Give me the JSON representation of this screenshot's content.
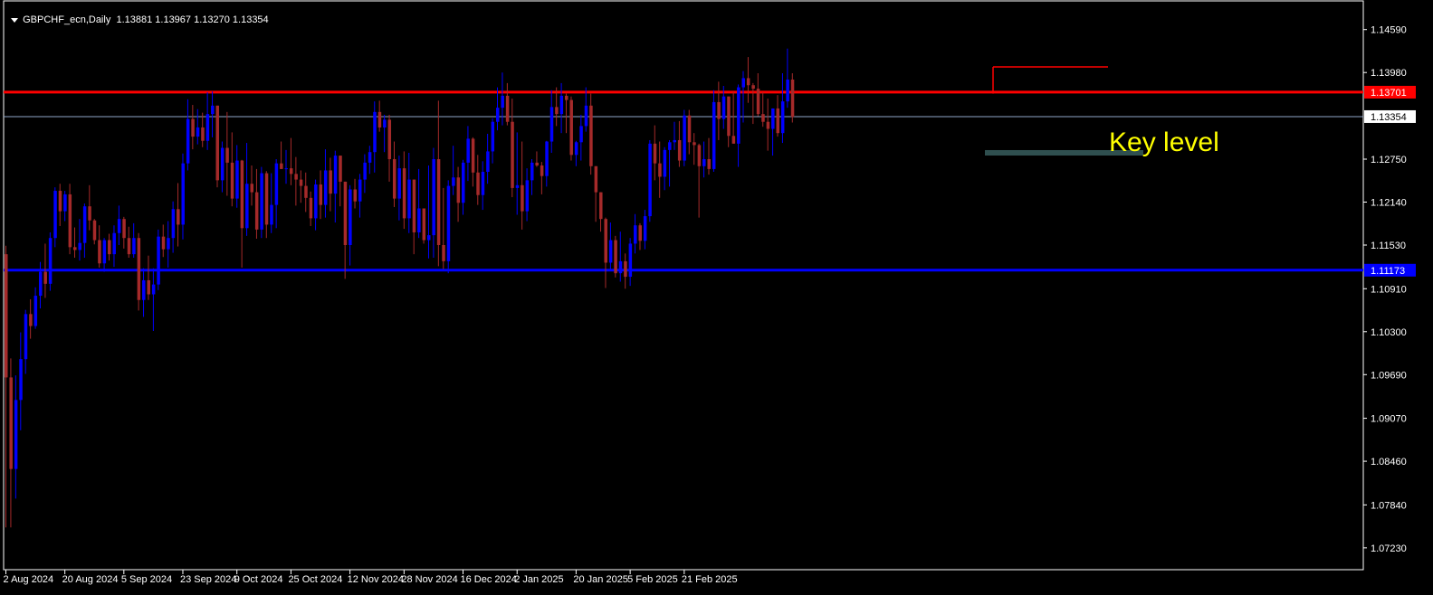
{
  "header": {
    "symbol_timeframe": "GBPCHF_ecn,Daily",
    "ohlc": "1.13881 1.13967 1.13270 1.13354"
  },
  "annotation": {
    "text": "Key level"
  },
  "colors": {
    "background": "#000000",
    "bull": "#0000ff",
    "bear": "#a52a2a",
    "axis": "#ffffff",
    "resistance": "#ff0000",
    "support": "#0000ff",
    "key_zone": "#2f4f4f",
    "annotation": "#ffff00"
  },
  "chart_data": {
    "type": "candlestick",
    "title": "GBPCHF_ecn,Daily",
    "ylim": [
      1.0692,
      1.1501
    ],
    "y_ticks": [
      "1.14590",
      "1.13980",
      "1.12750",
      "1.12140",
      "1.11530",
      "1.10910",
      "1.10300",
      "1.09690",
      "1.09070",
      "1.08460",
      "1.07840",
      "1.07230"
    ],
    "x_ticks": [
      "2 Aug 2024",
      "20 Aug 2024",
      "5 Sep 2024",
      "23 Sep 2024",
      "9 Oct 2024",
      "25 Oct 2024",
      "12 Nov 2024",
      "28 Nov 2024",
      "16 Dec 2024",
      "2 Jan 2025",
      "20 Jan 2025",
      "5 Feb 2025",
      "21 Feb 2025"
    ],
    "levels": [
      {
        "label": "1.13701",
        "price": 1.13701,
        "color": "#ff0000"
      },
      {
        "label": "1.11173",
        "price": 1.11173,
        "color": "#0000ff"
      }
    ],
    "current_price": {
      "label": "1.13354",
      "price": 1.13354
    },
    "key_zone": {
      "price": 1.1284,
      "label": "Key level"
    },
    "range_top": {
      "price": 1.1406
    },
    "candles": [
      {
        "o": 1.114,
        "h": 1.1152,
        "l": 1.0752,
        "c": 1.0965
      },
      {
        "o": 1.0965,
        "h": 1.0992,
        "l": 1.0752,
        "c": 1.0835
      },
      {
        "o": 1.0835,
        "h": 1.0968,
        "l": 1.0793,
        "c": 1.0933
      },
      {
        "o": 1.0933,
        "h": 1.1029,
        "l": 1.089,
        "c": 1.0991
      },
      {
        "o": 1.0991,
        "h": 1.1061,
        "l": 1.097,
        "c": 1.1055
      },
      {
        "o": 1.1055,
        "h": 1.1076,
        "l": 1.102,
        "c": 1.1038
      },
      {
        "o": 1.1038,
        "h": 1.1093,
        "l": 1.1034,
        "c": 1.1081
      },
      {
        "o": 1.1081,
        "h": 1.1129,
        "l": 1.1063,
        "c": 1.1115
      },
      {
        "o": 1.1115,
        "h": 1.1155,
        "l": 1.1078,
        "c": 1.1098
      },
      {
        "o": 1.1098,
        "h": 1.1171,
        "l": 1.1088,
        "c": 1.1163
      },
      {
        "o": 1.1163,
        "h": 1.1235,
        "l": 1.115,
        "c": 1.123
      },
      {
        "o": 1.123,
        "h": 1.124,
        "l": 1.118,
        "c": 1.1201
      },
      {
        "o": 1.1201,
        "h": 1.123,
        "l": 1.1187,
        "c": 1.1225
      },
      {
        "o": 1.1225,
        "h": 1.124,
        "l": 1.114,
        "c": 1.115
      },
      {
        "o": 1.115,
        "h": 1.1178,
        "l": 1.1135,
        "c": 1.1146
      },
      {
        "o": 1.1146,
        "h": 1.119,
        "l": 1.1131,
        "c": 1.1156
      },
      {
        "o": 1.1156,
        "h": 1.1212,
        "l": 1.1135,
        "c": 1.1208
      },
      {
        "o": 1.1208,
        "h": 1.1238,
        "l": 1.1174,
        "c": 1.1188
      },
      {
        "o": 1.1188,
        "h": 1.119,
        "l": 1.1154,
        "c": 1.116
      },
      {
        "o": 1.116,
        "h": 1.1181,
        "l": 1.1121,
        "c": 1.1127
      },
      {
        "o": 1.1127,
        "h": 1.1163,
        "l": 1.1115,
        "c": 1.116
      },
      {
        "o": 1.116,
        "h": 1.1169,
        "l": 1.1131,
        "c": 1.114
      },
      {
        "o": 1.114,
        "h": 1.1181,
        "l": 1.1122,
        "c": 1.117
      },
      {
        "o": 1.117,
        "h": 1.1209,
        "l": 1.1153,
        "c": 1.119
      },
      {
        "o": 1.119,
        "h": 1.1193,
        "l": 1.1148,
        "c": 1.1163
      },
      {
        "o": 1.1163,
        "h": 1.1179,
        "l": 1.1135,
        "c": 1.114
      },
      {
        "o": 1.114,
        "h": 1.1184,
        "l": 1.1135,
        "c": 1.1163
      },
      {
        "o": 1.1163,
        "h": 1.117,
        "l": 1.106,
        "c": 1.1075
      },
      {
        "o": 1.1075,
        "h": 1.112,
        "l": 1.1051,
        "c": 1.1103
      },
      {
        "o": 1.1103,
        "h": 1.1138,
        "l": 1.1075,
        "c": 1.1083
      },
      {
        "o": 1.1083,
        "h": 1.112,
        "l": 1.1031,
        "c": 1.1097
      },
      {
        "o": 1.1097,
        "h": 1.1175,
        "l": 1.1089,
        "c": 1.1165
      },
      {
        "o": 1.1165,
        "h": 1.1182,
        "l": 1.1136,
        "c": 1.1147
      },
      {
        "o": 1.1147,
        "h": 1.1187,
        "l": 1.1121,
        "c": 1.1163
      },
      {
        "o": 1.1163,
        "h": 1.1215,
        "l": 1.1142,
        "c": 1.1204
      },
      {
        "o": 1.1204,
        "h": 1.1241,
        "l": 1.1151,
        "c": 1.1182
      },
      {
        "o": 1.1182,
        "h": 1.1283,
        "l": 1.1161,
        "c": 1.1269
      },
      {
        "o": 1.1269,
        "h": 1.136,
        "l": 1.1259,
        "c": 1.1332
      },
      {
        "o": 1.1332,
        "h": 1.1352,
        "l": 1.1289,
        "c": 1.1307
      },
      {
        "o": 1.1307,
        "h": 1.1346,
        "l": 1.1296,
        "c": 1.132
      },
      {
        "o": 1.132,
        "h": 1.1341,
        "l": 1.1292,
        "c": 1.1301
      },
      {
        "o": 1.1301,
        "h": 1.137,
        "l": 1.1288,
        "c": 1.1339
      },
      {
        "o": 1.1339,
        "h": 1.1371,
        "l": 1.1306,
        "c": 1.1351
      },
      {
        "o": 1.1351,
        "h": 1.1351,
        "l": 1.1235,
        "c": 1.1245
      },
      {
        "o": 1.1245,
        "h": 1.13,
        "l": 1.1228,
        "c": 1.1291
      },
      {
        "o": 1.1291,
        "h": 1.1342,
        "l": 1.1223,
        "c": 1.127
      },
      {
        "o": 1.127,
        "h": 1.1313,
        "l": 1.1208,
        "c": 1.1219
      },
      {
        "o": 1.1219,
        "h": 1.1295,
        "l": 1.1206,
        "c": 1.1273
      },
      {
        "o": 1.1273,
        "h": 1.1274,
        "l": 1.1121,
        "c": 1.1177
      },
      {
        "o": 1.1177,
        "h": 1.1298,
        "l": 1.1166,
        "c": 1.124
      },
      {
        "o": 1.124,
        "h": 1.1266,
        "l": 1.1209,
        "c": 1.1228
      },
      {
        "o": 1.1228,
        "h": 1.1261,
        "l": 1.1162,
        "c": 1.1175
      },
      {
        "o": 1.1175,
        "h": 1.1264,
        "l": 1.1163,
        "c": 1.1255
      },
      {
        "o": 1.1255,
        "h": 1.1258,
        "l": 1.1163,
        "c": 1.1182
      },
      {
        "o": 1.1182,
        "h": 1.1255,
        "l": 1.117,
        "c": 1.121
      },
      {
        "o": 1.121,
        "h": 1.1275,
        "l": 1.1177,
        "c": 1.1269
      },
      {
        "o": 1.1269,
        "h": 1.13,
        "l": 1.1264,
        "c": 1.1261
      },
      {
        "o": 1.1261,
        "h": 1.1288,
        "l": 1.124,
        "c": 1.1262
      },
      {
        "o": 1.1262,
        "h": 1.1305,
        "l": 1.1238,
        "c": 1.1254
      },
      {
        "o": 1.1254,
        "h": 1.1278,
        "l": 1.1209,
        "c": 1.1246
      },
      {
        "o": 1.1246,
        "h": 1.1259,
        "l": 1.1213,
        "c": 1.1237
      },
      {
        "o": 1.1237,
        "h": 1.1256,
        "l": 1.12,
        "c": 1.122
      },
      {
        "o": 1.122,
        "h": 1.1229,
        "l": 1.118,
        "c": 1.1191
      },
      {
        "o": 1.1191,
        "h": 1.1246,
        "l": 1.1174,
        "c": 1.1239
      },
      {
        "o": 1.1239,
        "h": 1.1259,
        "l": 1.119,
        "c": 1.121
      },
      {
        "o": 1.121,
        "h": 1.1289,
        "l": 1.1192,
        "c": 1.1259
      },
      {
        "o": 1.1259,
        "h": 1.1277,
        "l": 1.1201,
        "c": 1.1226
      },
      {
        "o": 1.1226,
        "h": 1.1287,
        "l": 1.1185,
        "c": 1.128
      },
      {
        "o": 1.128,
        "h": 1.1278,
        "l": 1.1208,
        "c": 1.1243
      },
      {
        "o": 1.1243,
        "h": 1.1236,
        "l": 1.1105,
        "c": 1.1153
      },
      {
        "o": 1.1153,
        "h": 1.1238,
        "l": 1.1124,
        "c": 1.1232
      },
      {
        "o": 1.1232,
        "h": 1.1247,
        "l": 1.1205,
        "c": 1.1215
      },
      {
        "o": 1.1215,
        "h": 1.1254,
        "l": 1.1192,
        "c": 1.1246
      },
      {
        "o": 1.1246,
        "h": 1.1282,
        "l": 1.1227,
        "c": 1.127
      },
      {
        "o": 1.127,
        "h": 1.1294,
        "l": 1.1254,
        "c": 1.1285
      },
      {
        "o": 1.1285,
        "h": 1.1357,
        "l": 1.1256,
        "c": 1.1342
      },
      {
        "o": 1.1342,
        "h": 1.1358,
        "l": 1.1314,
        "c": 1.132
      },
      {
        "o": 1.132,
        "h": 1.1338,
        "l": 1.1285,
        "c": 1.1331
      },
      {
        "o": 1.1331,
        "h": 1.1338,
        "l": 1.1243,
        "c": 1.1275
      },
      {
        "o": 1.1275,
        "h": 1.13,
        "l": 1.1207,
        "c": 1.1219
      },
      {
        "o": 1.1219,
        "h": 1.128,
        "l": 1.1188,
        "c": 1.1262
      },
      {
        "o": 1.1262,
        "h": 1.1286,
        "l": 1.1176,
        "c": 1.1191
      },
      {
        "o": 1.1191,
        "h": 1.1284,
        "l": 1.117,
        "c": 1.1246
      },
      {
        "o": 1.1246,
        "h": 1.1246,
        "l": 1.114,
        "c": 1.1171
      },
      {
        "o": 1.1171,
        "h": 1.1261,
        "l": 1.1163,
        "c": 1.1205
      },
      {
        "o": 1.1205,
        "h": 1.1191,
        "l": 1.1155,
        "c": 1.116
      },
      {
        "o": 1.116,
        "h": 1.1266,
        "l": 1.1134,
        "c": 1.1167
      },
      {
        "o": 1.1167,
        "h": 1.1291,
        "l": 1.1135,
        "c": 1.1275
      },
      {
        "o": 1.1275,
        "h": 1.1358,
        "l": 1.1123,
        "c": 1.1153
      },
      {
        "o": 1.1153,
        "h": 1.1234,
        "l": 1.1119,
        "c": 1.113
      },
      {
        "o": 1.113,
        "h": 1.1245,
        "l": 1.1113,
        "c": 1.1237
      },
      {
        "o": 1.1237,
        "h": 1.1294,
        "l": 1.1224,
        "c": 1.1249
      },
      {
        "o": 1.1249,
        "h": 1.1264,
        "l": 1.1186,
        "c": 1.1213
      },
      {
        "o": 1.1213,
        "h": 1.1274,
        "l": 1.1196,
        "c": 1.127
      },
      {
        "o": 1.127,
        "h": 1.1322,
        "l": 1.1244,
        "c": 1.1304
      },
      {
        "o": 1.1304,
        "h": 1.1306,
        "l": 1.1236,
        "c": 1.1256
      },
      {
        "o": 1.1256,
        "h": 1.1281,
        "l": 1.121,
        "c": 1.1224
      },
      {
        "o": 1.1224,
        "h": 1.1272,
        "l": 1.1203,
        "c": 1.1257
      },
      {
        "o": 1.1257,
        "h": 1.1311,
        "l": 1.124,
        "c": 1.1286
      },
      {
        "o": 1.1286,
        "h": 1.1333,
        "l": 1.1269,
        "c": 1.1328
      },
      {
        "o": 1.1328,
        "h": 1.1377,
        "l": 1.1316,
        "c": 1.1348
      },
      {
        "o": 1.1348,
        "h": 1.1398,
        "l": 1.1323,
        "c": 1.1365
      },
      {
        "o": 1.1365,
        "h": 1.1383,
        "l": 1.1323,
        "c": 1.1328
      },
      {
        "o": 1.1328,
        "h": 1.1361,
        "l": 1.1221,
        "c": 1.1234
      },
      {
        "o": 1.1234,
        "h": 1.1313,
        "l": 1.1196,
        "c": 1.1238
      },
      {
        "o": 1.1238,
        "h": 1.13,
        "l": 1.1175,
        "c": 1.1201
      },
      {
        "o": 1.1201,
        "h": 1.1262,
        "l": 1.1187,
        "c": 1.1245
      },
      {
        "o": 1.1245,
        "h": 1.1275,
        "l": 1.1224,
        "c": 1.127
      },
      {
        "o": 1.127,
        "h": 1.1286,
        "l": 1.1264,
        "c": 1.1266
      },
      {
        "o": 1.1266,
        "h": 1.1271,
        "l": 1.1225,
        "c": 1.1251
      },
      {
        "o": 1.1251,
        "h": 1.1301,
        "l": 1.1236,
        "c": 1.13
      },
      {
        "o": 1.13,
        "h": 1.1373,
        "l": 1.1284,
        "c": 1.1349
      },
      {
        "o": 1.1349,
        "h": 1.1377,
        "l": 1.1322,
        "c": 1.1339
      },
      {
        "o": 1.1339,
        "h": 1.1383,
        "l": 1.1312,
        "c": 1.1365
      },
      {
        "o": 1.1365,
        "h": 1.1368,
        "l": 1.1312,
        "c": 1.1359
      },
      {
        "o": 1.1359,
        "h": 1.1364,
        "l": 1.1273,
        "c": 1.1281
      },
      {
        "o": 1.1281,
        "h": 1.1301,
        "l": 1.1265,
        "c": 1.1299
      },
      {
        "o": 1.1299,
        "h": 1.1338,
        "l": 1.1273,
        "c": 1.1322
      },
      {
        "o": 1.1322,
        "h": 1.1377,
        "l": 1.1314,
        "c": 1.1351
      },
      {
        "o": 1.1351,
        "h": 1.1368,
        "l": 1.1253,
        "c": 1.1265
      },
      {
        "o": 1.1265,
        "h": 1.1264,
        "l": 1.1186,
        "c": 1.1228
      },
      {
        "o": 1.1228,
        "h": 1.1225,
        "l": 1.1172,
        "c": 1.119
      },
      {
        "o": 1.119,
        "h": 1.1192,
        "l": 1.1092,
        "c": 1.1128
      },
      {
        "o": 1.1128,
        "h": 1.1185,
        "l": 1.1117,
        "c": 1.116
      },
      {
        "o": 1.116,
        "h": 1.1166,
        "l": 1.1107,
        "c": 1.1113
      },
      {
        "o": 1.1113,
        "h": 1.1172,
        "l": 1.1101,
        "c": 1.113
      },
      {
        "o": 1.113,
        "h": 1.1141,
        "l": 1.1091,
        "c": 1.1108
      },
      {
        "o": 1.1108,
        "h": 1.1163,
        "l": 1.1095,
        "c": 1.1155
      },
      {
        "o": 1.1155,
        "h": 1.1197,
        "l": 1.1141,
        "c": 1.1181
      },
      {
        "o": 1.1181,
        "h": 1.1184,
        "l": 1.1146,
        "c": 1.1159
      },
      {
        "o": 1.1159,
        "h": 1.1203,
        "l": 1.1147,
        "c": 1.1194
      },
      {
        "o": 1.1194,
        "h": 1.1302,
        "l": 1.1186,
        "c": 1.1297
      },
      {
        "o": 1.1297,
        "h": 1.1323,
        "l": 1.1245,
        "c": 1.1269
      },
      {
        "o": 1.1269,
        "h": 1.13,
        "l": 1.122,
        "c": 1.125
      },
      {
        "o": 1.125,
        "h": 1.1292,
        "l": 1.1231,
        "c": 1.1288
      },
      {
        "o": 1.1288,
        "h": 1.1302,
        "l": 1.1236,
        "c": 1.1299
      },
      {
        "o": 1.1299,
        "h": 1.1328,
        "l": 1.1288,
        "c": 1.1302
      },
      {
        "o": 1.1302,
        "h": 1.1329,
        "l": 1.1264,
        "c": 1.1273
      },
      {
        "o": 1.1273,
        "h": 1.1345,
        "l": 1.1265,
        "c": 1.1337
      },
      {
        "o": 1.1337,
        "h": 1.1345,
        "l": 1.1282,
        "c": 1.1299
      },
      {
        "o": 1.1299,
        "h": 1.1312,
        "l": 1.1267,
        "c": 1.1295
      },
      {
        "o": 1.1295,
        "h": 1.1297,
        "l": 1.1192,
        "c": 1.1265
      },
      {
        "o": 1.1265,
        "h": 1.13,
        "l": 1.1249,
        "c": 1.1275
      },
      {
        "o": 1.1275,
        "h": 1.1305,
        "l": 1.1253,
        "c": 1.1261
      },
      {
        "o": 1.1261,
        "h": 1.1373,
        "l": 1.1257,
        "c": 1.1356
      },
      {
        "o": 1.1356,
        "h": 1.1385,
        "l": 1.1302,
        "c": 1.1332
      },
      {
        "o": 1.1332,
        "h": 1.1379,
        "l": 1.1318,
        "c": 1.1364
      },
      {
        "o": 1.1364,
        "h": 1.1362,
        "l": 1.1292,
        "c": 1.1308
      },
      {
        "o": 1.1308,
        "h": 1.1371,
        "l": 1.1298,
        "c": 1.1297
      },
      {
        "o": 1.1297,
        "h": 1.1381,
        "l": 1.1264,
        "c": 1.1377
      },
      {
        "o": 1.1377,
        "h": 1.14,
        "l": 1.1327,
        "c": 1.139
      },
      {
        "o": 1.139,
        "h": 1.142,
        "l": 1.1355,
        "c": 1.138
      },
      {
        "o": 1.138,
        "h": 1.1383,
        "l": 1.1325,
        "c": 1.1375
      },
      {
        "o": 1.1375,
        "h": 1.1397,
        "l": 1.1336,
        "c": 1.1339
      },
      {
        "o": 1.1339,
        "h": 1.137,
        "l": 1.1321,
        "c": 1.1328
      },
      {
        "o": 1.1328,
        "h": 1.1361,
        "l": 1.1287,
        "c": 1.1318
      },
      {
        "o": 1.1318,
        "h": 1.134,
        "l": 1.128,
        "c": 1.1347
      },
      {
        "o": 1.1347,
        "h": 1.1366,
        "l": 1.1307,
        "c": 1.1312
      },
      {
        "o": 1.1312,
        "h": 1.1397,
        "l": 1.1298,
        "c": 1.1357
      },
      {
        "o": 1.1357,
        "h": 1.1432,
        "l": 1.1348,
        "c": 1.1388
      },
      {
        "o": 1.1388,
        "h": 1.1397,
        "l": 1.1327,
        "c": 1.1335
      }
    ]
  }
}
